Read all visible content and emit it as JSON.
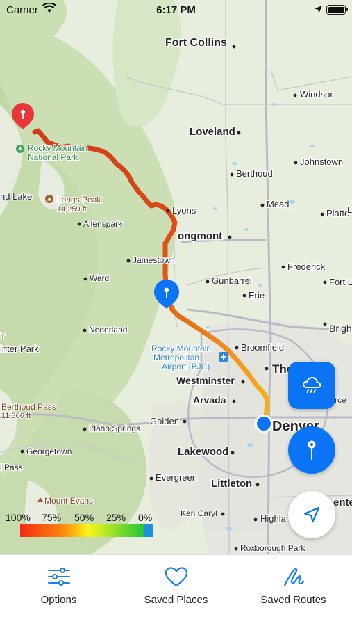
{
  "status_bar": {
    "carrier": "Carrier",
    "time": "6:17 PM"
  },
  "map": {
    "places": [
      {
        "id": "fort-collins",
        "name": "Fort Collins",
        "kind": "city"
      },
      {
        "id": "windsor",
        "name": "Windsor",
        "kind": "town"
      },
      {
        "id": "loveland",
        "name": "Loveland",
        "kind": "city"
      },
      {
        "id": "berthoud",
        "name": "Berthoud",
        "kind": "town"
      },
      {
        "id": "johnstown",
        "name": "Johnstown",
        "kind": "town"
      },
      {
        "id": "mead",
        "name": "Mead",
        "kind": "town"
      },
      {
        "id": "platteville",
        "name": "Platte",
        "kind": "town"
      },
      {
        "id": "lyons",
        "name": "Lyons",
        "kind": "town"
      },
      {
        "id": "longmont",
        "name": "Longmont",
        "kind": "city",
        "display": "ongmont"
      },
      {
        "id": "allenspark",
        "name": "Allenspark",
        "kind": "town"
      },
      {
        "id": "jamestown",
        "name": "Jamestown",
        "kind": "town"
      },
      {
        "id": "frederick",
        "name": "Frederick",
        "kind": "town"
      },
      {
        "id": "ward",
        "name": "Ward",
        "kind": "town"
      },
      {
        "id": "gunbarrel",
        "name": "Gunbarrel",
        "kind": "town"
      },
      {
        "id": "fort-lupton",
        "name": "Fort L",
        "kind": "town"
      },
      {
        "id": "erie",
        "name": "Erie",
        "kind": "town"
      },
      {
        "id": "nederland",
        "name": "Nederland",
        "kind": "town"
      },
      {
        "id": "brighton",
        "name": "Brigh",
        "kind": "town"
      },
      {
        "id": "winter-park",
        "name": "inter Park",
        "kind": "town"
      },
      {
        "id": "broomfield",
        "name": "Broomfield",
        "kind": "town"
      },
      {
        "id": "thornton",
        "name": "The",
        "kind": "city"
      },
      {
        "id": "westminster",
        "name": "Westminster",
        "kind": "city"
      },
      {
        "id": "arvada",
        "name": "Arvada",
        "kind": "city"
      },
      {
        "id": "commerce-city",
        "name": "rce",
        "kind": "town"
      },
      {
        "id": "golden",
        "name": "Golden",
        "kind": "town"
      },
      {
        "id": "denver",
        "name": "Denver",
        "kind": "major"
      },
      {
        "id": "idaho-springs",
        "name": "Idaho Springs",
        "kind": "town"
      },
      {
        "id": "georgetown",
        "name": "Georgetown",
        "kind": "town"
      },
      {
        "id": "lakewood",
        "name": "Lakewood",
        "kind": "city"
      },
      {
        "id": "evergreen",
        "name": "Evergreen",
        "kind": "town"
      },
      {
        "id": "littleton",
        "name": "Littleton",
        "kind": "city"
      },
      {
        "id": "centennial",
        "name": "ente",
        "kind": "city"
      },
      {
        "id": "ken-caryl",
        "name": "Ken Caryl",
        "kind": "town"
      },
      {
        "id": "highlands-ranch",
        "name": "Highla",
        "kind": "town"
      },
      {
        "id": "roxborough-park",
        "name": "Roxborough Park",
        "kind": "town"
      },
      {
        "id": "grand-lake",
        "name": "nd Lake",
        "kind": "town"
      },
      {
        "id": "loveland-pass",
        "name": "l Pass",
        "kind": "town"
      },
      {
        "id": "lake-right",
        "name": "L",
        "kind": "town"
      }
    ],
    "park_label_1": "Rocky Mountain",
    "park_label_2": "National Park",
    "airport_label_1": "Rocky Mountain",
    "airport_label_2": "Metropolitan",
    "airport_label_3": "Airport (BJC)",
    "peaks": [
      {
        "id": "longs-peak",
        "name": "Longs Peak",
        "elevation": "14,259 ft"
      },
      {
        "id": "berthoud-pass",
        "name": "Berthoud Pass",
        "elevation": "11,306 ft"
      },
      {
        "id": "mount-evans",
        "name": "Mount Evans",
        "elevation": ""
      },
      {
        "id": "i-peak",
        "name": "ir",
        "elevation": ""
      }
    ],
    "route": {
      "gradient": "percent-remaining",
      "colors": [
        "#e4252a",
        "#f47b20",
        "#f7a11a",
        "#f1e41a",
        "#2db84a",
        "#1c8fe6"
      ]
    }
  },
  "legend": {
    "labels": [
      "100%",
      "75%",
      "50%",
      "25%",
      "0%"
    ],
    "colors": {
      "start": "#f42a14",
      "orange": "#fc8a0c",
      "yellow": "#f9f51a",
      "green": "#22c53c",
      "blue": "#1e8fe0"
    }
  },
  "buttons": {
    "weather_icon": "cloud-rain-icon",
    "pin_icon": "map-pin-icon",
    "locate_icon": "navigation-arrow-icon"
  },
  "tabs": [
    {
      "id": "options",
      "label": "Options",
      "icon": "sliders-icon"
    },
    {
      "id": "saved-places",
      "label": "Saved Places",
      "icon": "heart-icon"
    },
    {
      "id": "saved-routes",
      "label": "Saved Routes",
      "icon": "squiggle-route-icon"
    }
  ],
  "colors": {
    "accent": "#0a74f5",
    "tab_icon": "#1a7ff2",
    "pin_red": "#e8363a"
  }
}
